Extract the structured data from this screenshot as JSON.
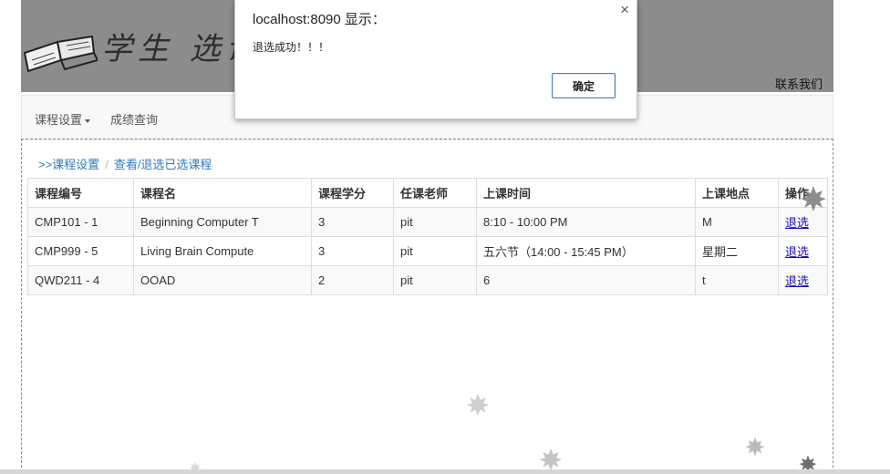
{
  "header": {
    "logo_text": "学生 选课",
    "contact_label": "联系我们"
  },
  "nav": {
    "items": [
      {
        "label": "课程设置",
        "dropdown": true
      },
      {
        "label": "成绩查询",
        "dropdown": false
      }
    ]
  },
  "breadcrumb": {
    "items": [
      ">>课程设置",
      "查看/退选已选课程"
    ]
  },
  "table": {
    "columns": [
      "课程编号",
      "课程名",
      "课程学分",
      "任课老师",
      "上课时间",
      "上课地点",
      "操作"
    ],
    "rows": [
      {
        "id": "CMP101 - 1",
        "name": "Beginning Computer T",
        "credit": "3",
        "teacher": "pit",
        "time": "8:10 - 10:00 PM",
        "place": "M",
        "action": "退选"
      },
      {
        "id": "CMP999 - 5",
        "name": "Living Brain Compute",
        "credit": "3",
        "teacher": "pit",
        "time": "五六节（14:00 - 15:45 PM）",
        "place": "星期二",
        "action": "退选"
      },
      {
        "id": "QWD211 - 4",
        "name": "OOAD",
        "credit": "2",
        "teacher": "pit",
        "time": "6",
        "place": "t",
        "action": "退选"
      }
    ]
  },
  "dialog": {
    "title": "localhost:8090 显示：",
    "message": "退选成功！！！",
    "ok_label": "确定",
    "close_glyph": "×"
  },
  "colors": {
    "banner_bg": "#8c8c8c",
    "link": "#337ab7",
    "action_link": "#1a0dab",
    "dialog_button_border": "#4a7fb8"
  }
}
